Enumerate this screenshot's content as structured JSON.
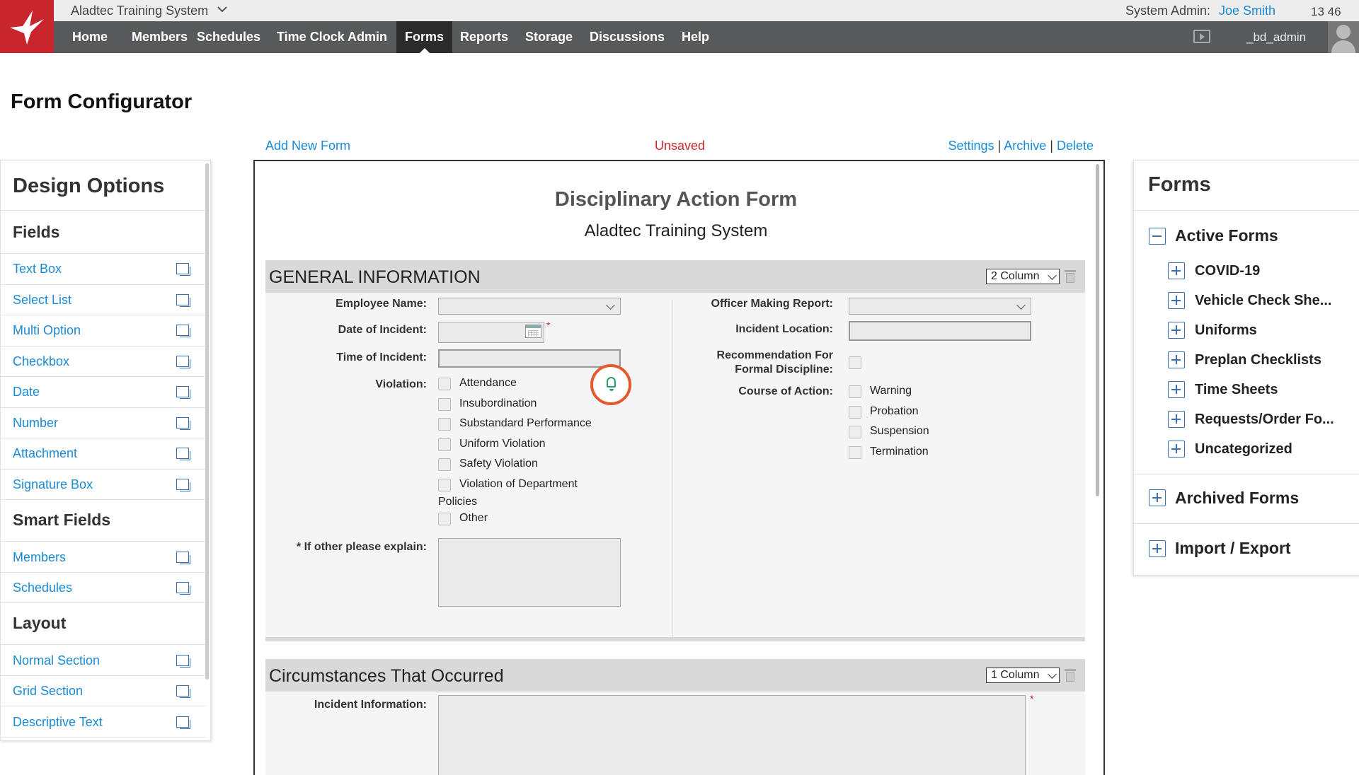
{
  "topbar": {
    "system_name": "Aladtec Training System",
    "admin_label": "System Admin:",
    "admin_user": "Joe Smith",
    "time": "13 46",
    "account": "_bd_admin"
  },
  "nav": {
    "items": [
      "Home",
      "Members",
      "Schedules",
      "Time Clock Admin",
      "Forms",
      "Reports",
      "Storage",
      "Discussions",
      "Help"
    ],
    "active": "Forms"
  },
  "page": {
    "title": "Form Configurator"
  },
  "toolbar": {
    "add_new_form": "Add New Form",
    "status": "Unsaved",
    "settings": "Settings",
    "archive": "Archive",
    "delete": "Delete",
    "separator": "|"
  },
  "design_options": {
    "title": "Design Options",
    "fields_heading": "Fields",
    "fields": [
      "Text Box",
      "Select List",
      "Multi Option",
      "Checkbox",
      "Date",
      "Number",
      "Attachment",
      "Signature Box"
    ],
    "smart_fields_heading": "Smart Fields",
    "smart_fields": [
      "Members",
      "Schedules"
    ],
    "layout_heading": "Layout",
    "layout": [
      "Normal Section",
      "Grid Section",
      "Descriptive Text"
    ]
  },
  "form": {
    "title": "Disciplinary Action Form",
    "subtitle": "Aladtec Training System",
    "general": {
      "heading": "GENERAL INFORMATION",
      "column_select": "2 Column",
      "employee_name_label": "Employee Name:",
      "date_label": "Date of Incident:",
      "time_label": "Time of Incident:",
      "violation_label": "Violation:",
      "violations": [
        "Attendance",
        "Insubordination",
        "Substandard Performance",
        "Uniform Violation",
        "Safety Violation",
        "Violation of Department",
        "Other"
      ],
      "violation_wrap": "Policies",
      "other_explain_label": "* If other please explain:",
      "officer_label": "Officer Making Report:",
      "location_label": "Incident Location:",
      "recommendation_label_1": "Recommendation For",
      "recommendation_label_2": "Formal Discipline:",
      "course_label": "Course of Action:",
      "courses": [
        "Warning",
        "Probation",
        "Suspension",
        "Termination"
      ],
      "required_mark": "*"
    },
    "circumstances": {
      "heading": "Circumstances That Occurred",
      "column_select": "1 Column",
      "incident_info_label": "Incident Information:"
    }
  },
  "forms_panel": {
    "title": "Forms",
    "active_heading": "Active Forms",
    "active_items": [
      "COVID-19",
      "Vehicle Check She...",
      "Uniforms",
      "Preplan Checklists",
      "Time Sheets",
      "Requests/Order Fo...",
      "Uncategorized"
    ],
    "archived_heading": "Archived Forms",
    "import_export_heading": "Import / Export"
  },
  "colors": {
    "brand_red": "#c8262c",
    "link_blue": "#1a8ad4",
    "nav_bg": "#58595b",
    "nav_active": "#2b2b2b",
    "highlight_ring": "#e45a2c"
  }
}
